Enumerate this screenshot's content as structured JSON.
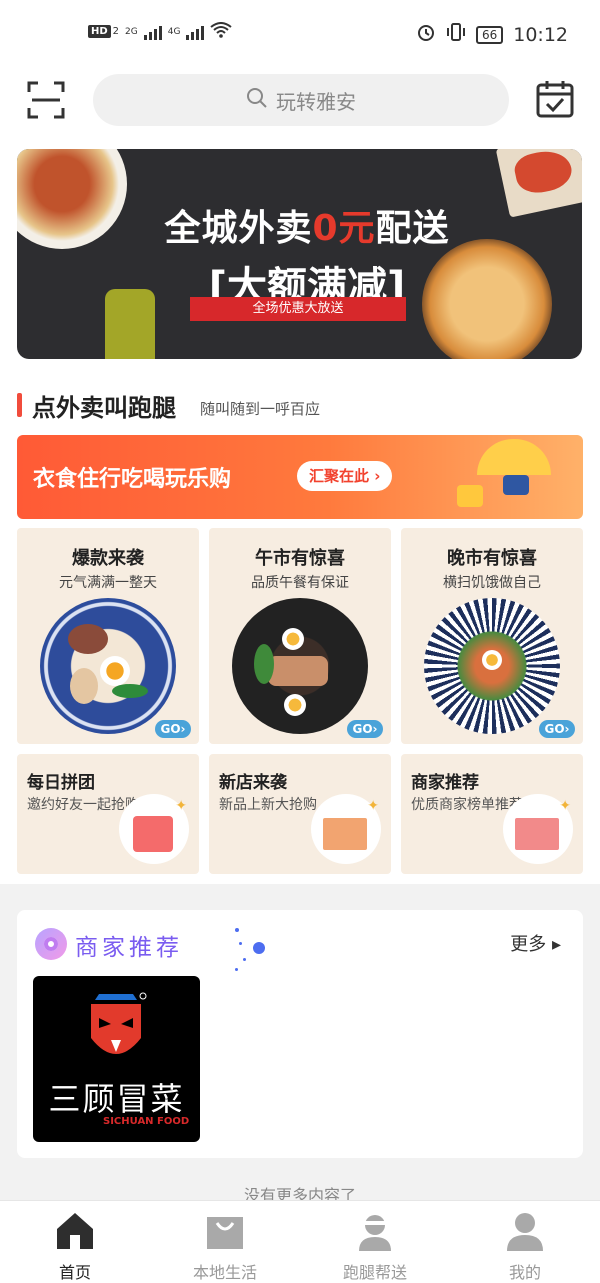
{
  "status_bar": {
    "network": "HD",
    "sim": "2",
    "sig1": "2G",
    "sig2": "4G",
    "battery": "66",
    "time": "10:12"
  },
  "header": {
    "scan_icon": "scan-icon",
    "search_placeholder": "玩转雅安",
    "calendar_icon": "calendar-check-icon"
  },
  "banner": {
    "line1_a": "全城外卖",
    "line1_b": "0元",
    "line1_c": "配送",
    "line2": "[大额满减]",
    "ribbon": "全场优惠大放送"
  },
  "section": {
    "title": "点外卖叫跑腿",
    "subtitle": "随叫随到一呼百应"
  },
  "promo": {
    "text": "衣食住行吃喝玩乐购",
    "button": "汇聚在此 ›"
  },
  "big_cards": [
    {
      "title": "爆款来袭",
      "subtitle": "元气满满一整天",
      "go": "GO›"
    },
    {
      "title": "午市有惊喜",
      "subtitle": "品质午餐有保证",
      "go": "GO›"
    },
    {
      "title": "晚市有惊喜",
      "subtitle": "横扫饥饿做自己",
      "go": "GO›"
    }
  ],
  "small_cards": [
    {
      "title": "每日拼团",
      "subtitle": "邀约好友一起抢购"
    },
    {
      "title": "新店来袭",
      "subtitle": "新品上新大抢购"
    },
    {
      "title": "商家推荐",
      "subtitle": "优质商家榜单推荐"
    }
  ],
  "merchants": {
    "title": "商家推荐",
    "more": "更多 ▸",
    "logo_text": "三顾冒菜",
    "logo_sub": "SICHUAN FOOD"
  },
  "no_more": "没有更多内容了",
  "tabs": [
    {
      "label": "首页",
      "icon": "home-icon"
    },
    {
      "label": "本地生活",
      "icon": "shopping-bag-icon"
    },
    {
      "label": "跑腿帮送",
      "icon": "courier-icon"
    },
    {
      "label": "我的",
      "icon": "user-icon"
    }
  ],
  "colors": {
    "accent_red": "#f14c3c",
    "promo_orange": "#ff6a3a",
    "card_bg": "#f7ede1",
    "merchant_title": "#7a5cf0"
  }
}
